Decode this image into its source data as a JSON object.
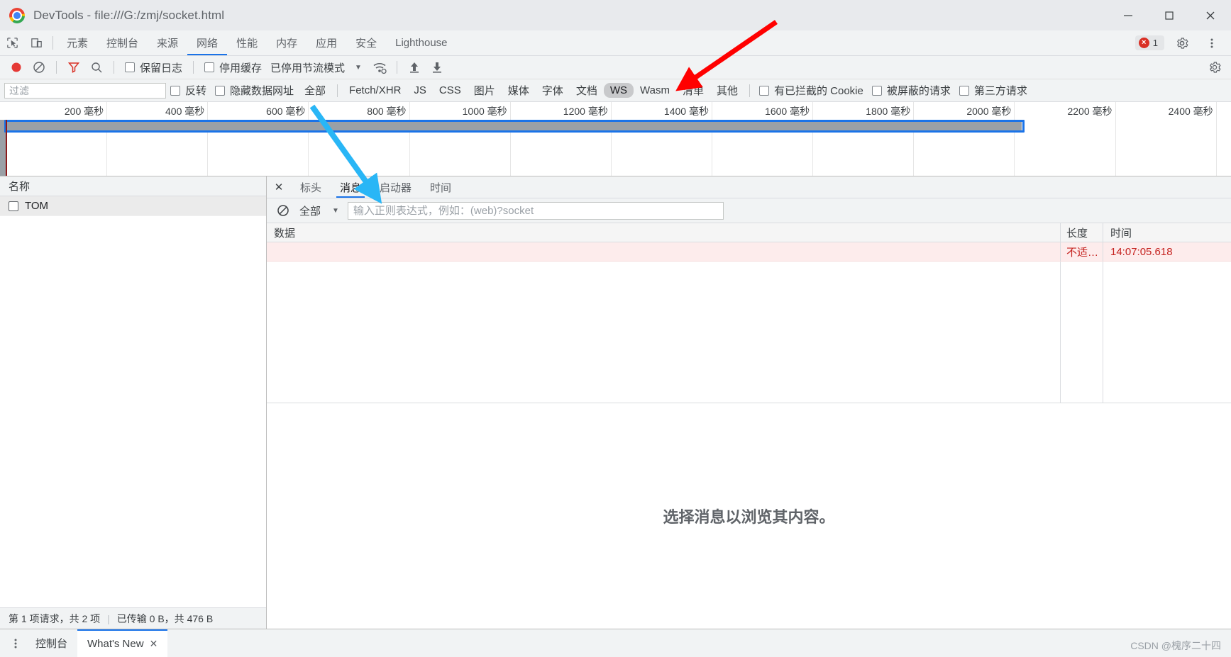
{
  "window": {
    "title": "DevTools - file:///G:/zmj/socket.html",
    "minimize_label": "—",
    "maximize_label": "☐",
    "close_label": "✕"
  },
  "main_tabs": {
    "inspect_icon": "inspect-cursor-icon",
    "device_icon": "device-toolbar-icon",
    "items": [
      {
        "label": "元素",
        "selected": false
      },
      {
        "label": "控制台",
        "selected": false
      },
      {
        "label": "来源",
        "selected": false
      },
      {
        "label": "网络",
        "selected": true
      },
      {
        "label": "性能",
        "selected": false
      },
      {
        "label": "内存",
        "selected": false
      },
      {
        "label": "应用",
        "selected": false
      },
      {
        "label": "安全",
        "selected": false
      },
      {
        "label": "Lighthouse",
        "selected": false
      }
    ],
    "error_count": "1",
    "settings_icon": "gear-icon",
    "more_icon": "more-vertical-icon"
  },
  "network_toolbar": {
    "record_icon": "record-circle-icon",
    "clear_icon": "clear-prohibited-icon",
    "filter_icon": "funnel-filter-icon",
    "search_icon": "search-icon",
    "preserve_log_label": "保留日志",
    "preserve_log_checked": false,
    "disable_cache_label": "停用缓存",
    "disable_cache_checked": false,
    "throttling_label": "已停用节流模式",
    "throttling_caret": "▼",
    "wifi_icon": "wifi-settings-icon",
    "import_icon": "upload-arrow-icon",
    "export_icon": "download-arrow-icon",
    "settings_icon": "gear-icon"
  },
  "filter_bar": {
    "filter_placeholder": "过滤",
    "filter_value": "",
    "invert_label": "反转",
    "invert_checked": false,
    "hide_data_urls_label": "隐藏数据网址",
    "hide_data_urls_checked": false,
    "types": [
      {
        "label": "全部",
        "active": false
      },
      {
        "label": "Fetch/XHR",
        "active": false
      },
      {
        "label": "JS",
        "active": false
      },
      {
        "label": "CSS",
        "active": false
      },
      {
        "label": "图片",
        "active": false
      },
      {
        "label": "媒体",
        "active": false
      },
      {
        "label": "字体",
        "active": false
      },
      {
        "label": "文档",
        "active": false
      },
      {
        "label": "WS",
        "active": true
      },
      {
        "label": "Wasm",
        "active": false
      },
      {
        "label": "清单",
        "active": false
      },
      {
        "label": "其他",
        "active": false
      }
    ],
    "blocked_cookies_label": "有已拦截的 Cookie",
    "blocked_cookies_checked": false,
    "blocked_requests_label": "被屏蔽的请求",
    "blocked_requests_checked": false,
    "third_party_label": "第三方请求",
    "third_party_checked": false
  },
  "overview": {
    "ticks": [
      "200 毫秒",
      "400 毫秒",
      "600 毫秒",
      "800 毫秒",
      "1000 毫秒",
      "1200 毫秒",
      "1400 毫秒",
      "1600 毫秒",
      "1800 毫秒",
      "2000 毫秒",
      "2200 毫秒",
      "2400 毫秒"
    ]
  },
  "requests_pane": {
    "header": "名称",
    "rows": [
      {
        "name": "TOM",
        "icon": "websocket-request-icon",
        "selected": true
      }
    ],
    "status_requests": "第 1 项请求，共 2 项",
    "status_sep": "|",
    "status_transfer": "已传输 0 B，共 476 B"
  },
  "details_pane": {
    "close_icon": "✕",
    "tabs": [
      {
        "label": "标头",
        "selected": false
      },
      {
        "label": "消息",
        "selected": true
      },
      {
        "label": "启动器",
        "selected": false
      },
      {
        "label": "时间",
        "selected": false
      }
    ],
    "messages_toolbar": {
      "clear_icon": "clear-prohibited-icon",
      "type_filter_label": "全部",
      "type_filter_caret": "▼",
      "regex_placeholder": "输入正则表达式，例如：(web)?socket",
      "regex_value": ""
    },
    "messages_table": {
      "columns": [
        "数据",
        "长度",
        "时间"
      ],
      "rows": [
        {
          "data": "",
          "length": "不适…",
          "time": "14:07:05.618"
        }
      ]
    },
    "empty_state": "选择消息以浏览其内容。"
  },
  "drawer": {
    "menu_icon": "more-vertical-icon",
    "tabs": [
      {
        "label": "控制台",
        "selected": false,
        "closable": false
      },
      {
        "label": "What's New",
        "selected": true,
        "closable": true
      }
    ],
    "close_icon": "✕",
    "watermark": "CSDN @槐序二十四"
  },
  "colors": {
    "accent": "#1a73e8",
    "error": "#d93025",
    "record": "#e53935",
    "bar": "#9aa0a6"
  }
}
